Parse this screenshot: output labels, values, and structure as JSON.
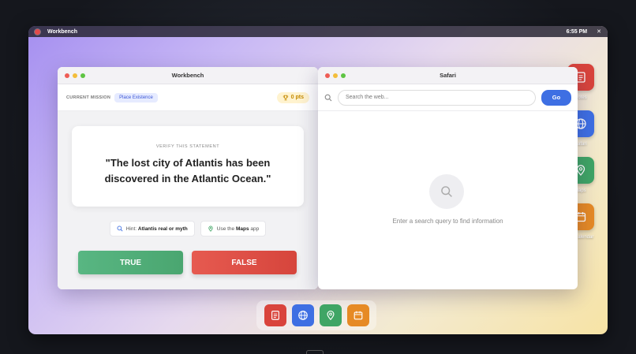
{
  "menubar": {
    "app_name": "Workbench",
    "time": "6:55 PM",
    "close_label": "✕"
  },
  "desktop_icons": [
    {
      "name": "notes-icon",
      "label": "Notes",
      "color": "#d9443c"
    },
    {
      "name": "browser-icon",
      "label": "Safari",
      "color": "#3e6fe3"
    },
    {
      "name": "maps-icon",
      "label": "Maps",
      "color": "#3fa565"
    },
    {
      "name": "calendar-icon",
      "label": "Calendar",
      "color": "#e68a25"
    }
  ],
  "workbench": {
    "title": "Workbench",
    "mission_label": "CURRENT MISSION",
    "mission_name": "Place Existence",
    "points": "0 pts",
    "card_label": "VERIFY THIS STATEMENT",
    "statement": "\"The lost city of Atlantis has been discovered in the Atlantic Ocean.\"",
    "hint_prefix": "Hint: ",
    "hint_bold": "Atlantis real or myth",
    "maps_prefix": "Use the ",
    "maps_bold": "Maps",
    "maps_suffix": " app",
    "true_label": "TRUE",
    "false_label": "FALSE"
  },
  "safari": {
    "title": "Safari",
    "search_placeholder": "Search the web...",
    "go_label": "Go",
    "empty_message": "Enter a search query to find information"
  },
  "dock": [
    {
      "name": "dock-notes-icon",
      "color": "#d9443c"
    },
    {
      "name": "dock-browser-icon",
      "color": "#3e6fe3"
    },
    {
      "name": "dock-maps-icon",
      "color": "#3fa565"
    },
    {
      "name": "dock-calendar-icon",
      "color": "#e68a25"
    }
  ]
}
